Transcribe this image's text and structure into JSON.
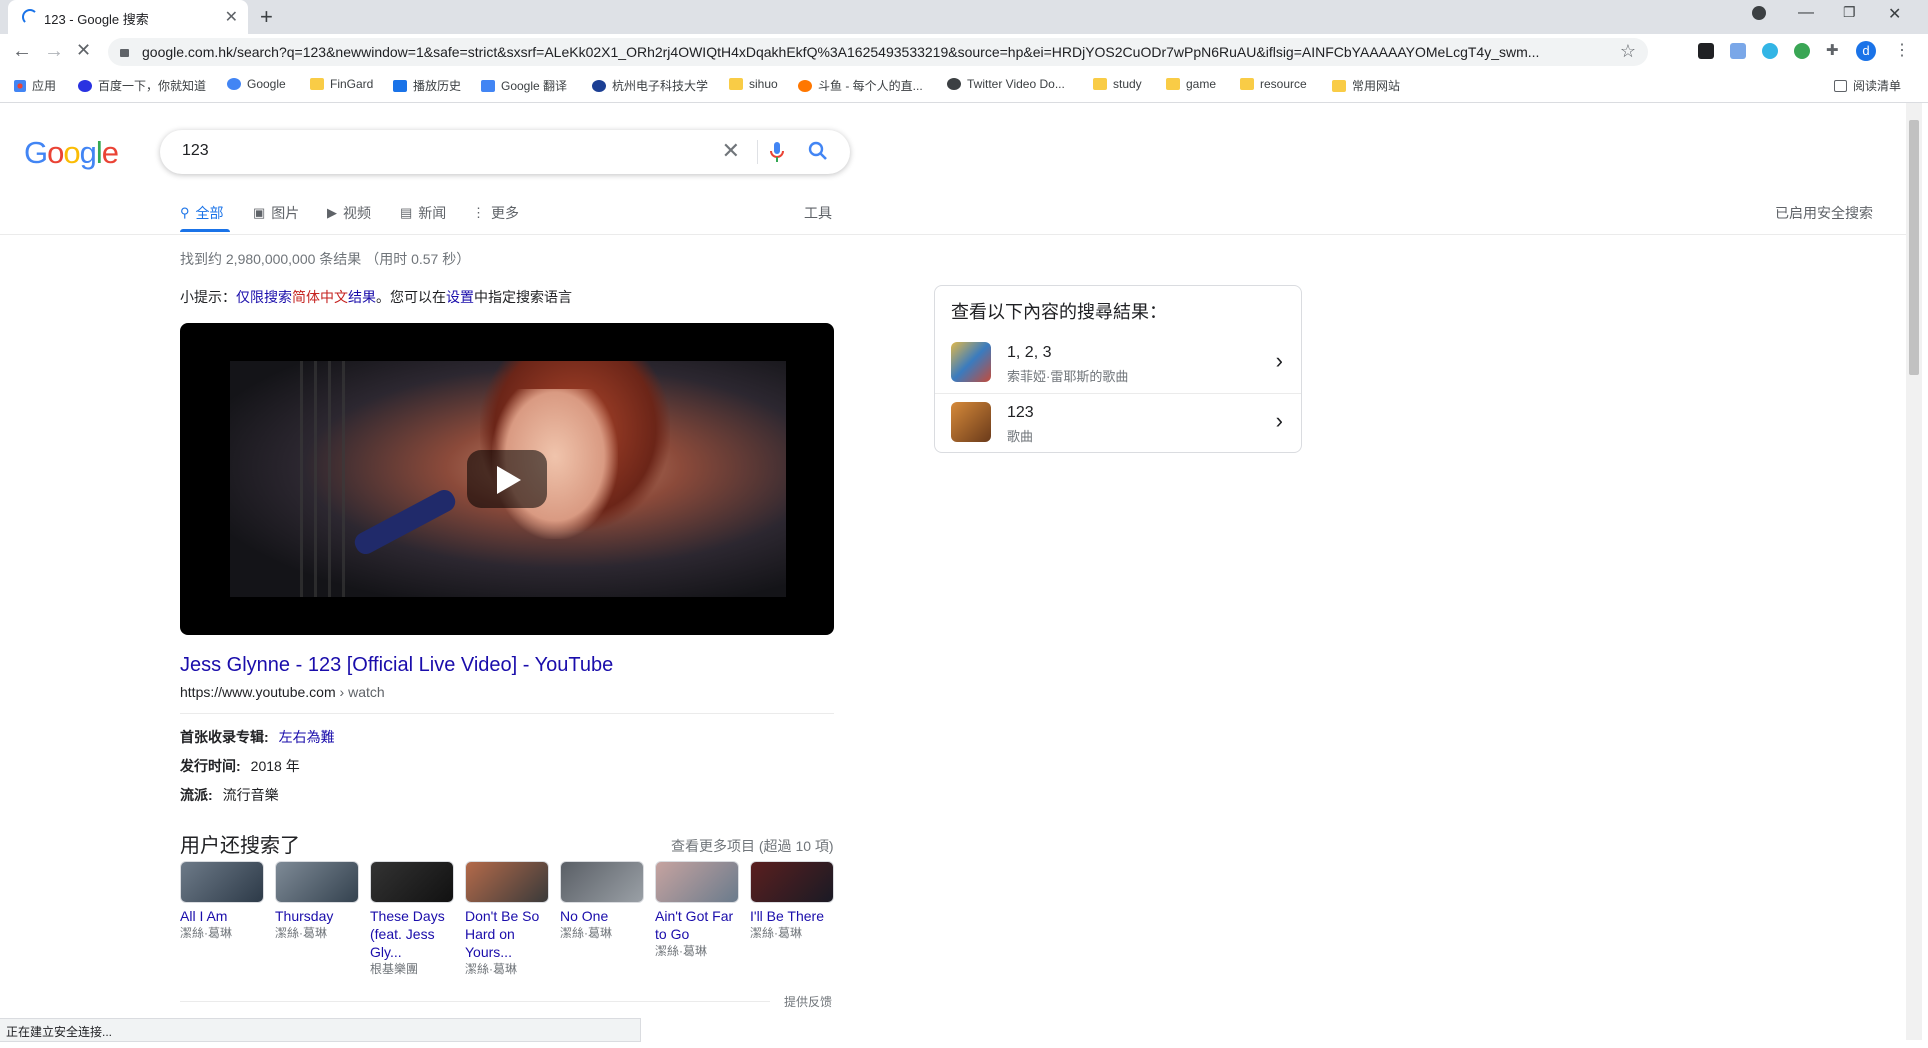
{
  "browser": {
    "tab_title": "123 - Google 搜索",
    "url": "google.com.hk/search?q=123&newwindow=1&safe=strict&sxsrf=ALeKk02X1_ORh2rj4OWIQtH4xDqakhEkfQ%3A1625493533219&source=hp&ei=HRDjYOS2CuODr7wPpN6RuAU&iflsig=AINFCbYAAAAAYOMeLcgT4y_swm...",
    "profile_initial": "d",
    "bookmarks": [
      "应用",
      "百度一下，你就知道",
      "Google",
      "FinGard",
      "播放历史",
      "Google 翻译",
      "杭州电子科技大学",
      "sihuo",
      "斗鱼 - 每个人的直...",
      "Twitter Video Do...",
      "study",
      "game",
      "resource",
      "常用网站"
    ],
    "reading_list": "阅读清单",
    "status_text": "正在建立安全连接..."
  },
  "search": {
    "logo": "Google",
    "query": "123",
    "tabs": {
      "all": "全部",
      "images": "图片",
      "videos": "视频",
      "news": "新闻",
      "more": "更多"
    },
    "tools": "工具",
    "safesearch": "已启用安全搜索",
    "stats": "找到约 2,980,000,000 条结果 （用时 0.57 秒）",
    "tip": {
      "prefix": "小提示：",
      "link1": "仅限搜索",
      "red": "简体中文",
      "link2": "结果",
      "mid": "。您可以在",
      "settings": "设置",
      "suffix": "中指定搜索语言"
    }
  },
  "result": {
    "title": "Jess Glynne - 123 [Official Live Video] - YouTube",
    "url": "https://www.youtube.com",
    "crumb": " › watch",
    "album_label": "首张收录专辑:",
    "album_value": "左右為難",
    "release_label": "发行时间:",
    "release_value": "2018 年",
    "genre_label": "流派:",
    "genre_value": "流行音樂"
  },
  "people_also": {
    "title": "用户还搜索了",
    "more": "查看更多项目 (超過 10 項)",
    "items": [
      {
        "name": "All I Am",
        "sub": "潔絲·葛琳"
      },
      {
        "name": "Thursday",
        "sub": "潔絲·葛琳"
      },
      {
        "name": "These Days (feat. Jess Gly...",
        "sub": "根基樂團"
      },
      {
        "name": "Don't Be So Hard on Yours...",
        "sub": "潔絲·葛琳"
      },
      {
        "name": "No One",
        "sub": "潔絲·葛琳"
      },
      {
        "name": "Ain't Got Far to Go",
        "sub": "潔絲·葛琳"
      },
      {
        "name": "I'll Be There",
        "sub": "潔絲·葛琳"
      }
    ],
    "feedback": "提供反馈"
  },
  "panel": {
    "heading": "查看以下內容的搜尋結果：",
    "rows": [
      {
        "title": "1, 2, 3",
        "sub": "索菲婭·雷耶斯的歌曲"
      },
      {
        "title": "123",
        "sub": "歌曲"
      }
    ]
  }
}
